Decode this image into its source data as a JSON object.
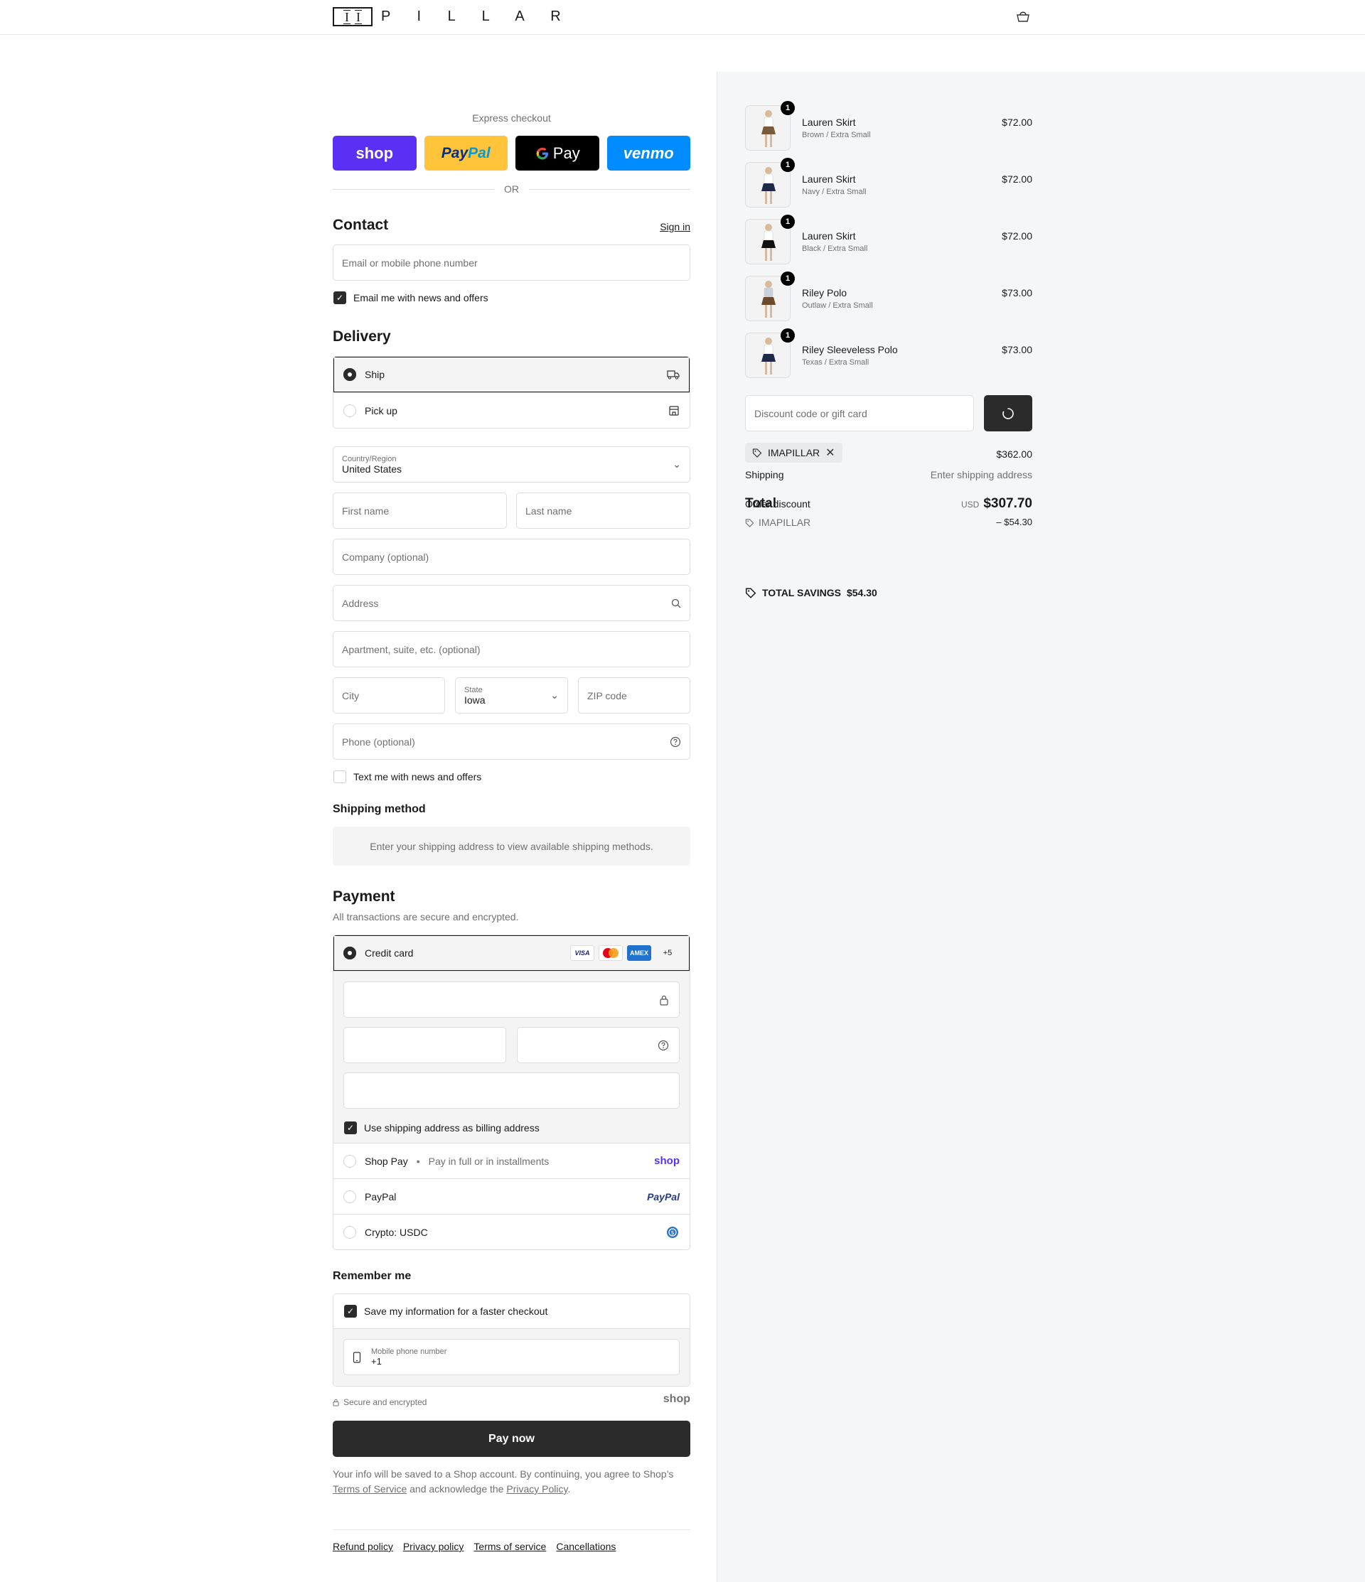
{
  "header": {
    "brand": "P I L L A R",
    "logo_mark": "I I"
  },
  "express": {
    "label": "Express checkout",
    "shop": "shop",
    "paypal_a": "Pay",
    "paypal_b": "Pal",
    "gpay": "Pay",
    "venmo": "venmo",
    "or": "OR"
  },
  "contact": {
    "title": "Contact",
    "signin": "Sign in",
    "email_placeholder": "Email or mobile phone number",
    "news_label": "Email me with news and offers"
  },
  "delivery": {
    "title": "Delivery",
    "ship": "Ship",
    "pickup": "Pick up",
    "country_label": "Country/Region",
    "country_value": "United States",
    "first_name": "First name",
    "last_name": "Last name",
    "company": "Company (optional)",
    "address": "Address",
    "apartment": "Apartment, suite, etc. (optional)",
    "city": "City",
    "state_label": "State",
    "state_value": "Iowa",
    "zip": "ZIP code",
    "phone": "Phone (optional)",
    "text_label": "Text me with news and offers"
  },
  "shipping_method": {
    "title": "Shipping method",
    "note": "Enter your shipping address to view available shipping methods."
  },
  "payment": {
    "title": "Payment",
    "subtitle": "All transactions are secure and encrypted.",
    "credit_card": "Credit card",
    "visa": "VISA",
    "amex": "AMEX",
    "more": "+5",
    "billing_label": "Use shipping address as billing address",
    "shop_pay": "Shop Pay",
    "shop_pay_sub": "Pay in full or in installments",
    "shop_logo": "shop",
    "paypal": "PayPal",
    "paypal_logo": "PayPal",
    "crypto": "Crypto: USDC"
  },
  "remember": {
    "title": "Remember me",
    "save_label": "Save my information for a faster checkout",
    "phone_label": "Mobile phone number",
    "phone_value": "+1",
    "secure": "Secure and encrypted",
    "shop_logo": "shop"
  },
  "pay_now": "Pay now",
  "disclaimer": {
    "a": "Your info will be saved to a Shop account. By continuing, you agree to Shop’s",
    "tos": "Terms of Service",
    "b": "and acknowledge the",
    "privacy": "Privacy Policy",
    "c": "."
  },
  "footer": [
    "Refund policy",
    "Privacy policy",
    "Terms of service",
    "Cancellations"
  ],
  "cart": {
    "items": [
      {
        "name": "Lauren Skirt",
        "variant": "Brown / Extra Small",
        "price": "$72.00",
        "qty": "1",
        "color": "#7a5a3a",
        "top": "#ffffff"
      },
      {
        "name": "Lauren Skirt",
        "variant": "Navy / Extra Small",
        "price": "$72.00",
        "qty": "1",
        "color": "#1f2a4a",
        "top": "#ffffff"
      },
      {
        "name": "Lauren Skirt",
        "variant": "Black / Extra Small",
        "price": "$72.00",
        "qty": "1",
        "color": "#111111",
        "top": "#ffffff"
      },
      {
        "name": "Riley Polo",
        "variant": "Outlaw / Extra Small",
        "price": "$73.00",
        "qty": "1",
        "color": "#6b4a2e",
        "top": "#c8d0dc"
      },
      {
        "name": "Riley Sleeveless Polo",
        "variant": "Texas / Extra Small",
        "price": "$73.00",
        "qty": "1",
        "color": "#1f2a4a",
        "top": "#ffffff"
      }
    ],
    "discount_placeholder": "Discount code or gift card",
    "tag": "IMAPILLAR",
    "subtotal_value": "$362.00",
    "shipping_label": "Shipping",
    "shipping_value": "Enter shipping address",
    "total_label": "Total",
    "order_discount_label": "Order discount",
    "currency": "USD",
    "total_value": "$307.70",
    "discount_code": "IMAPILLAR",
    "discount_value": "– $54.30",
    "savings_label": "TOTAL SAVINGS",
    "savings_value": "$54.30"
  }
}
